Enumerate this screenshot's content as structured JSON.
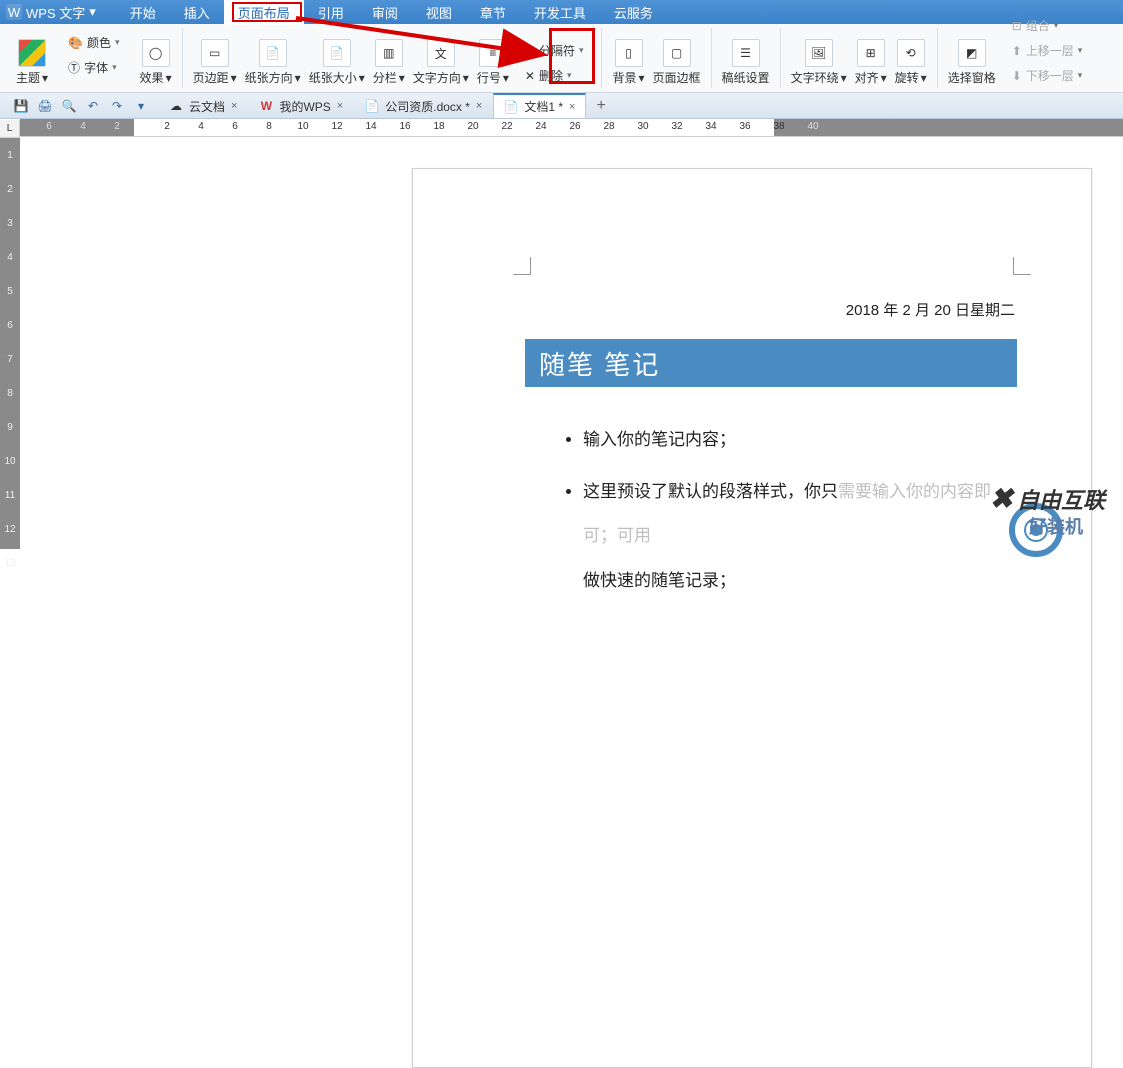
{
  "titlebar": {
    "product": "WPS 文字"
  },
  "menuTabs": {
    "start": "开始",
    "insert": "插入",
    "layout": "页面布局",
    "reference": "引用",
    "review": "审阅",
    "view": "视图",
    "section": "章节",
    "devtools": "开发工具",
    "cloud": "云服务"
  },
  "ribbon": {
    "theme": "主题",
    "font": "字体",
    "color": "颜色",
    "effect": "效果",
    "margin": "页边距",
    "orientation": "纸张方向",
    "size": "纸张大小",
    "columns": "分栏",
    "textDir": "文字方向",
    "lineNum": "行号",
    "breaks": "分隔符",
    "deleteBlank": "删除",
    "background": "背景",
    "pageBorder": "页面边框",
    "draft": "稿纸设置",
    "wrap": "文字环绕",
    "align": "对齐",
    "rotate": "旋转",
    "selection": "选择窗格",
    "combine": "组合",
    "moveUp": "上移一层",
    "moveDown": "下移一层"
  },
  "docTabs": {
    "cloudDoc": "云文档",
    "myWps": "我的WPS",
    "doc1": "公司资质.docx *",
    "doc2": "文档1 *"
  },
  "ruler": {
    "corner": "L"
  },
  "document": {
    "date": "2018 年 2 月 20 日星期二",
    "title": "随笔 笔记",
    "bullet1": "输入你的笔记内容；",
    "bullet2a": "这里预设了默认的段落样式，你只",
    "bullet2b": "需要输入你的内容即可；可用",
    "bullet2c": "做快速的随笔记录；"
  },
  "watermark": {
    "text1": "自由互联",
    "text2": "好装机"
  }
}
